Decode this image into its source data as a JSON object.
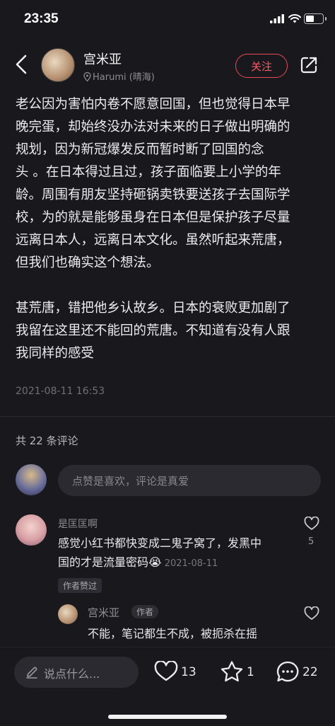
{
  "status_bar": {
    "time": "23:35"
  },
  "author": {
    "name": "宫米亚",
    "location": "Harumi (晴海)",
    "follow_label": "关注"
  },
  "post": {
    "lines": [
      "老公因为害怕内卷不愿意回国，但也觉得日本早",
      "晚完蛋，却始终没办法对未来的日子做出明确的",
      "规划，因为新冠爆发反而暂时断了回国的念",
      "头 。在日本得过且过，孩子面临要上小学的年",
      "龄。周围有朋友坚持砸锅卖铁要送孩子去国际学",
      "校，为的就是能够虽身在日本但是保护孩子尽量",
      "远离日本人，远离日本文化。虽然听起来荒唐，",
      "但我们也确实这个想法。",
      "",
      "甚荒唐，错把他乡认故乡。日本的衰败更加剧了",
      "我留在这里还不能回的荒唐。不知道有没有人跟",
      "我同样的感受"
    ],
    "date": "2021-08-11 16:53"
  },
  "comments_header": "共 22 条评论",
  "comment_input": {
    "placeholder": "点赞是喜欢，评论是真爱"
  },
  "comments": [
    {
      "user": "是匡匡啊",
      "line1": "感觉小红书都快变成二鬼子窝了，发黑中",
      "line2": "国的才是流量密码",
      "emoji": "😭",
      "date": "2021-08-11",
      "author_liked": "作者赞过",
      "likes": "5"
    }
  ],
  "reply": {
    "user": "宫米亚",
    "badge": "作者",
    "text": "不能，笔记都生不成，被扼杀在摇"
  },
  "bottom_bar": {
    "say_placeholder": "说点什么...",
    "likes": "13",
    "stars": "1",
    "comments": "22"
  },
  "colors": {
    "accent": "#ff5a66",
    "background": "#19181d"
  }
}
